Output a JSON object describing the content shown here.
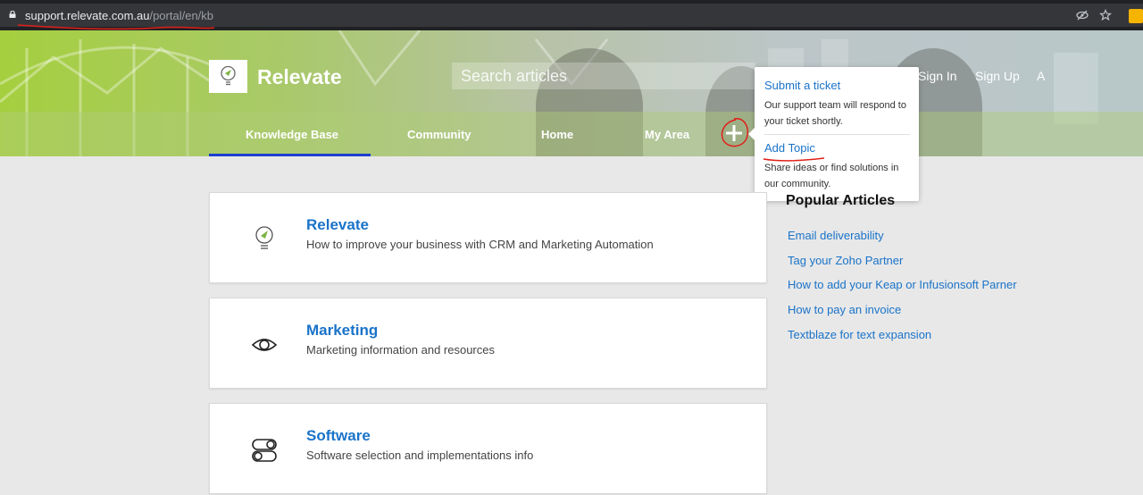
{
  "browser": {
    "url_host": "support.relevate.com.au",
    "url_path": "/portal/en/kb"
  },
  "header": {
    "brand": "Relevate",
    "search_placeholder": "Search articles",
    "sign_in": "Sign In",
    "sign_up": "Sign Up",
    "lang": "A"
  },
  "nav": {
    "items": [
      "Knowledge Base",
      "Community",
      "Home",
      "My Area"
    ],
    "active": "Knowledge Base"
  },
  "dropdown": {
    "items": [
      {
        "title": "Submit a ticket",
        "desc": "Our support team will respond to your ticket shortly."
      },
      {
        "title": "Add Topic",
        "desc": "Share ideas or find solutions in our community."
      }
    ]
  },
  "categories": [
    {
      "title": "Relevate",
      "desc": "How to improve your business with CRM and Marketing Automation",
      "icon": "lightbulb-icon"
    },
    {
      "title": "Marketing",
      "desc": "Marketing information and resources",
      "icon": "eye-icon"
    },
    {
      "title": "Software",
      "desc": "Software selection and implementations info",
      "icon": "toggle-icon"
    }
  ],
  "popular": {
    "heading": "Popular Articles",
    "links": [
      "Email deliverability",
      "Tag your Zoho Partner",
      "How to add your Keap or Infusionsoft Parner",
      "How to pay an invoice",
      "Textblaze for text expansion"
    ]
  },
  "colors": {
    "accent": "#1a73c9",
    "nav_active": "#1e3fd0",
    "annotation": "#e0201a"
  }
}
